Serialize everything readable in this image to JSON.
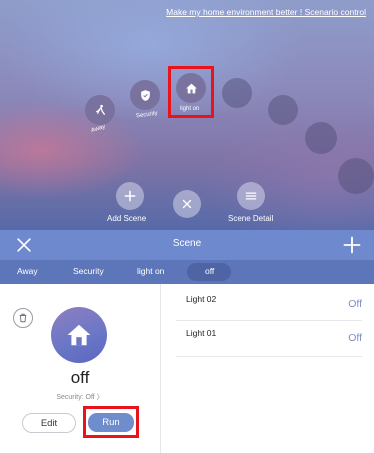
{
  "top": {
    "link_text": "Make my home environment better ! Scenario control",
    "scenes": [
      {
        "label": "Away",
        "icon": "walking-person-icon"
      },
      {
        "label": "Security",
        "icon": "shield-icon"
      },
      {
        "label": "light on",
        "icon": "home-icon"
      }
    ],
    "actions": {
      "add_label": "Add Scene",
      "detail_label": "Scene Detail"
    }
  },
  "header": {
    "title": "Scene"
  },
  "tabs": [
    {
      "label": "Away",
      "active": false
    },
    {
      "label": "Security",
      "active": false
    },
    {
      "label": "light on",
      "active": false
    },
    {
      "label": "off",
      "active": true
    }
  ],
  "scene_detail": {
    "name": "off",
    "subtitle": "Security: Off 〉",
    "edit_label": "Edit",
    "run_label": "Run",
    "icon": "home-icon"
  },
  "devices": [
    {
      "name": "Light 02",
      "state": "Off"
    },
    {
      "name": "Light 01",
      "state": "Off"
    }
  ],
  "colors": {
    "header": "#6e89cd",
    "tabs": "#5d76b9",
    "accent": "#7d8fc8",
    "highlight": "#e8131b"
  }
}
